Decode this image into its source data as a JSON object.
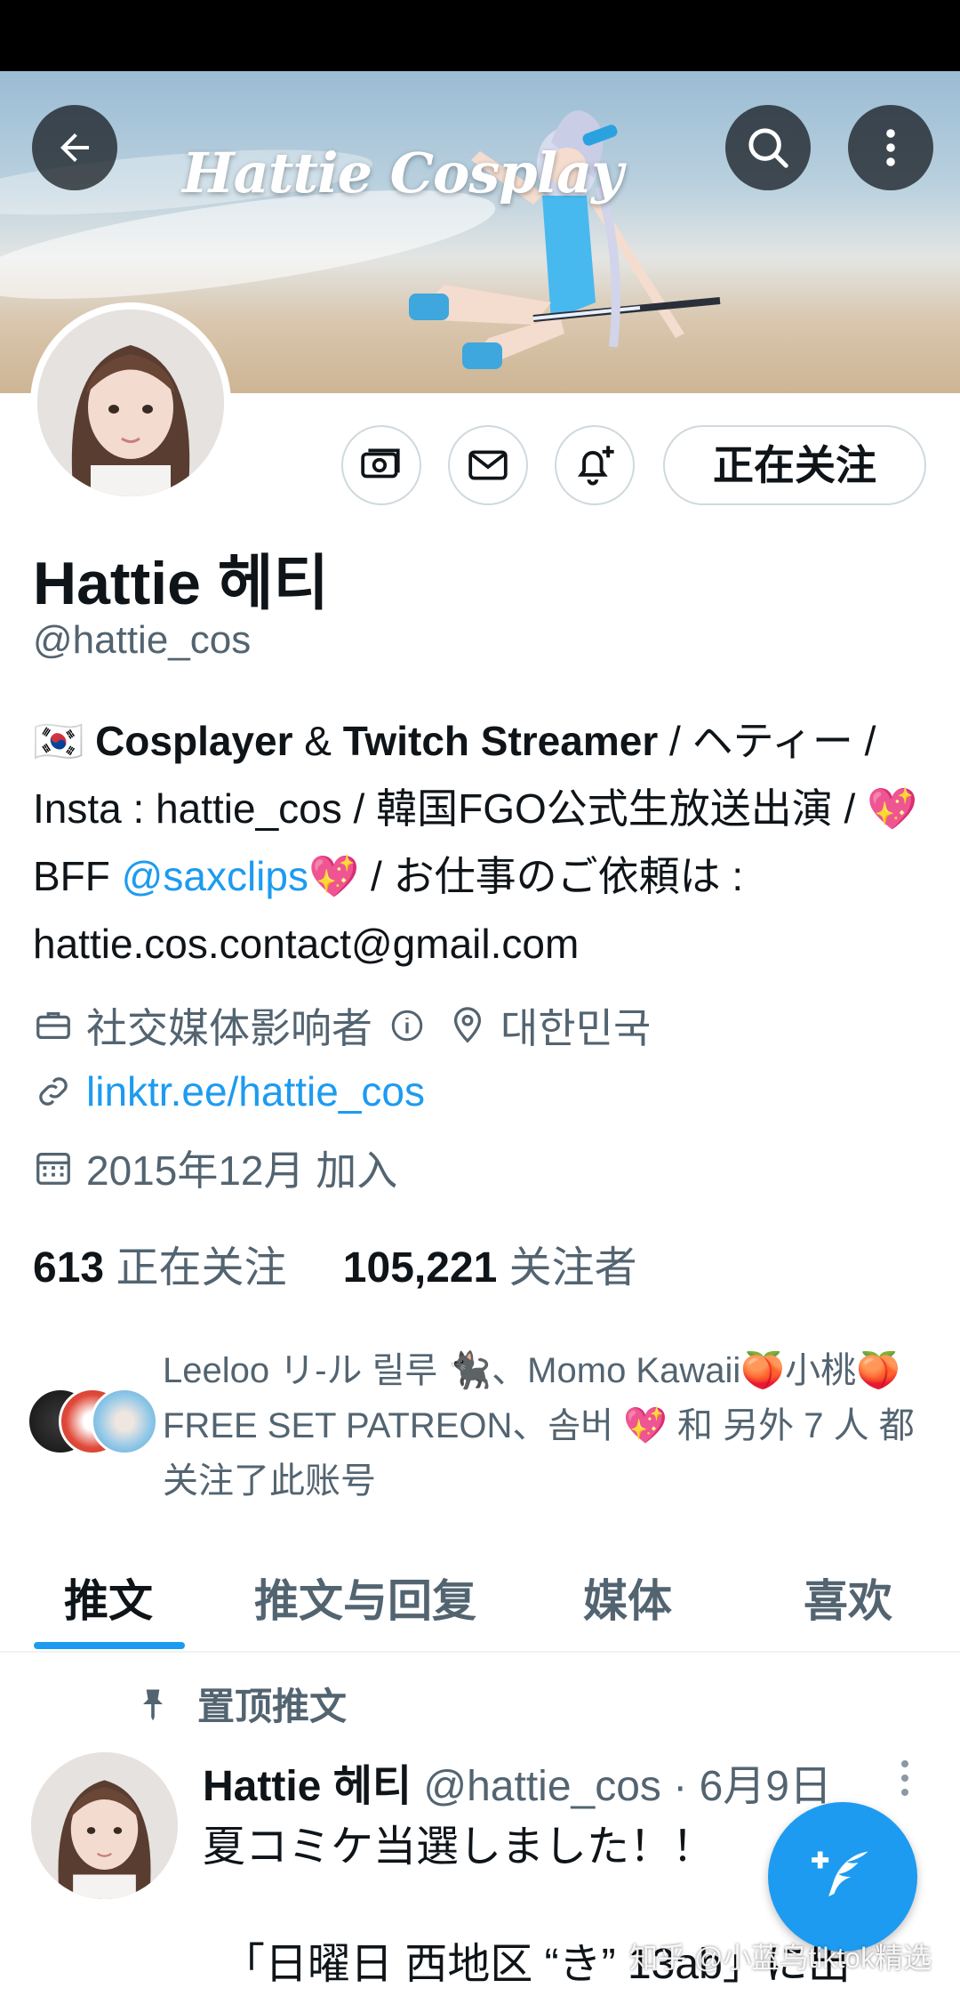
{
  "header": {
    "banner_title": "Hattie Cosplay",
    "back_icon": "arrow-left-icon",
    "search_icon": "search-icon",
    "more_icon": "more-vertical-icon"
  },
  "profile": {
    "name": "Hattie 헤티",
    "handle": "@hattie_cos",
    "actions": {
      "tip_icon": "money-icon",
      "message_icon": "mail-icon",
      "notify_icon": "bell-plus-icon",
      "follow_label": "正在关注"
    },
    "bio": {
      "flag": "🇰🇷",
      "part1_bold": "Cosplayer",
      "part2": " & ",
      "part3_bold": "Twitch Streamer",
      "part4": " / ヘティー / Insta : hattie_cos / 韓国FGO公式生放送出演 / ",
      "heart1": "💖",
      "part5": "BFF ",
      "mention": "@saxclips",
      "heart2": "💖",
      "part6": " / お仕事のご依頼は : hattie.cos.contact@gmail.com"
    },
    "category": "社交媒体影响者",
    "location": "대한민국",
    "link": "linktr.ee/hattie_cos",
    "joined": "2015年12月 加入",
    "following_count": "613",
    "following_label": "正在关注",
    "followers_count": "105,221",
    "followers_label": "关注者",
    "followed_by": "Leeloo リ-ル 릴루 🐈‍⬛、Momo Kawaii🍑小桃🍑 FREE SET PATREON、솜버 💖 和 另外 7 人 都关注了此账号"
  },
  "tabs": [
    {
      "label": "推文",
      "active": true
    },
    {
      "label": "推文与回复",
      "active": false
    },
    {
      "label": "媒体",
      "active": false
    },
    {
      "label": "喜欢",
      "active": false
    }
  ],
  "pinned_tweet": {
    "pinned_label": "置顶推文",
    "author_name": "Hattie 헤티",
    "author_handle": "@hattie_cos",
    "separator": " · ",
    "date": "6月9日",
    "text_line1": "夏コミケ当選しました！！",
    "text_line2": "「日曜日 西地区 “き” 13ab」に出"
  },
  "compose_icon": "feather-plus-icon",
  "watermark": "知乎 @小蓝鸟tiktok精选",
  "colors": {
    "accent": "#1d9bf0",
    "text_primary": "#0f1419",
    "text_secondary": "#536471",
    "border": "#cfd9de"
  }
}
